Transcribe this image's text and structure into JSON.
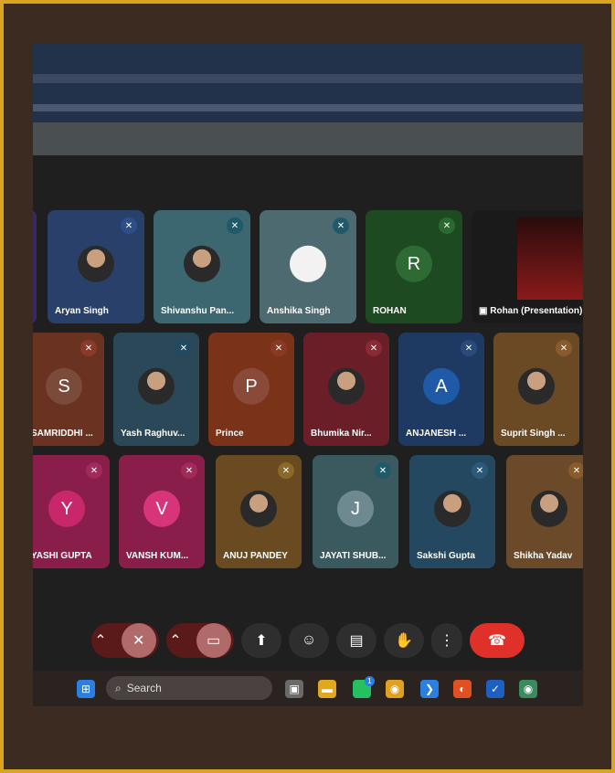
{
  "participants_row1": [
    {
      "name": "Aryan Singh",
      "color": "#28406a",
      "mic_color": "#2c4f8a"
    },
    {
      "name": "Shivanshu Pan...",
      "color": "#3c6670",
      "mic_color": "#1f5a6a"
    },
    {
      "name": "Anshika Singh",
      "color": "#4c6a70",
      "mic_color": "#1f5a6a"
    },
    {
      "name": "ROHAN",
      "color": "#1e4a22",
      "mic_color": "#2a6a30",
      "initial": "R"
    },
    {
      "name": "Rohan (Presentation)",
      "color": "#1a1a1a"
    }
  ],
  "participants_row2": [
    {
      "name": "SAMRIDDHI ...",
      "color": "#6a3220",
      "initial": "S"
    },
    {
      "name": "Yash Raghuv...",
      "color": "#2a4858"
    },
    {
      "name": "Prince",
      "color": "#7a3218",
      "initial": "P"
    },
    {
      "name": "Bhumika Nir...",
      "color": "#6a1e28"
    },
    {
      "name": "ANJANESH ...",
      "color": "#1e3a62",
      "initial": "A"
    },
    {
      "name": "Suprit Singh ...",
      "color": "#6a4a24"
    }
  ],
  "participants_row3": [
    {
      "name": "YASHI GUPTA",
      "color": "#8a1e4a",
      "initial": "Y"
    },
    {
      "name": "VANSH KUM...",
      "color": "#8a1e4a",
      "initial": "V"
    },
    {
      "name": "ANUJ PANDEY",
      "color": "#6a4a20"
    },
    {
      "name": "JAYATI SHUB...",
      "color": "#3a5a60",
      "initial": "J"
    },
    {
      "name": "Sakshi Gupta",
      "color": "#234860"
    },
    {
      "name": "Shikha Yadav",
      "color": "#6a4a28"
    }
  ],
  "taskbar": {
    "search_label": "Search",
    "whatsapp_badge": "1"
  },
  "colors": {
    "frame": "#d9a520",
    "end_call": "#e0302a"
  }
}
